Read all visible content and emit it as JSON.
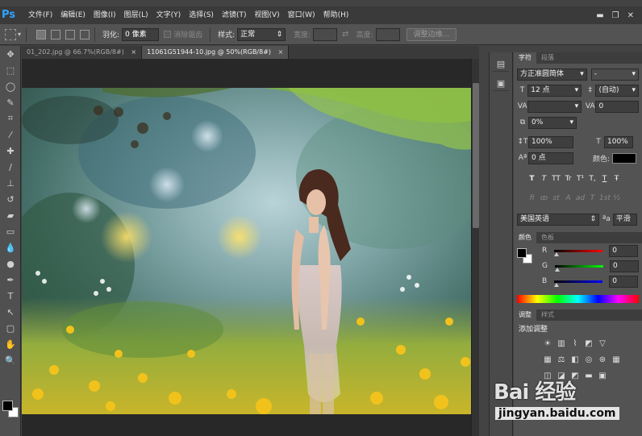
{
  "app": {
    "logo": "Ps"
  },
  "menu": [
    "文件(F)",
    "编辑(E)",
    "图像(I)",
    "图层(L)",
    "文字(Y)",
    "选择(S)",
    "滤镜(T)",
    "视图(V)",
    "窗口(W)",
    "帮助(H)"
  ],
  "window_controls": {
    "minimize": "▬",
    "restore": "❐",
    "close": "✕"
  },
  "options": {
    "feather_label": "羽化:",
    "feather_value": "0 像素",
    "antialias_label": "消除锯齿",
    "style_label": "样式:",
    "style_value": "正常",
    "width_label": "宽度:",
    "height_label": "高度:",
    "refine_edge": "调整边缘..."
  },
  "tabs": [
    {
      "label": "01_202.jpg @ 66.7%(RGB/8#)",
      "active": false
    },
    {
      "label": "11061G51944-10.jpg @ 50%(RGB/8#)",
      "active": true
    }
  ],
  "character_panel": {
    "tabs": [
      "字符",
      "段落"
    ],
    "font_family": "方正准圆简体",
    "font_style": "-",
    "font_size": "12 点",
    "leading": "(自动)",
    "tracking": "0",
    "scale_pct": "0%",
    "vertical_scale": "100%",
    "horizontal_scale": "100%",
    "baseline": "0 点",
    "color_label": "颜色:",
    "language": "美国英语",
    "antialias": "平滑",
    "aa_prefix": "ªa",
    "format_buttons": [
      "T",
      "T",
      "TT",
      "Tr",
      "T¹",
      "T,",
      "T",
      "Ŧ"
    ],
    "opentype_buttons": [
      "fi",
      "ꝏ",
      "st",
      "A",
      "ad",
      "T",
      "1st",
      "½"
    ]
  },
  "color_panel": {
    "tabs": [
      "颜色",
      "色板"
    ],
    "r_label": "R",
    "r_value": "0",
    "g_label": "G",
    "g_value": "0",
    "b_label": "B",
    "b_value": "0"
  },
  "adjustments_panel": {
    "tabs": [
      "调整",
      "样式"
    ],
    "title": "添加调整"
  },
  "watermark": {
    "brand": "Bai 经验",
    "url": "jingyan.baidu.com"
  }
}
